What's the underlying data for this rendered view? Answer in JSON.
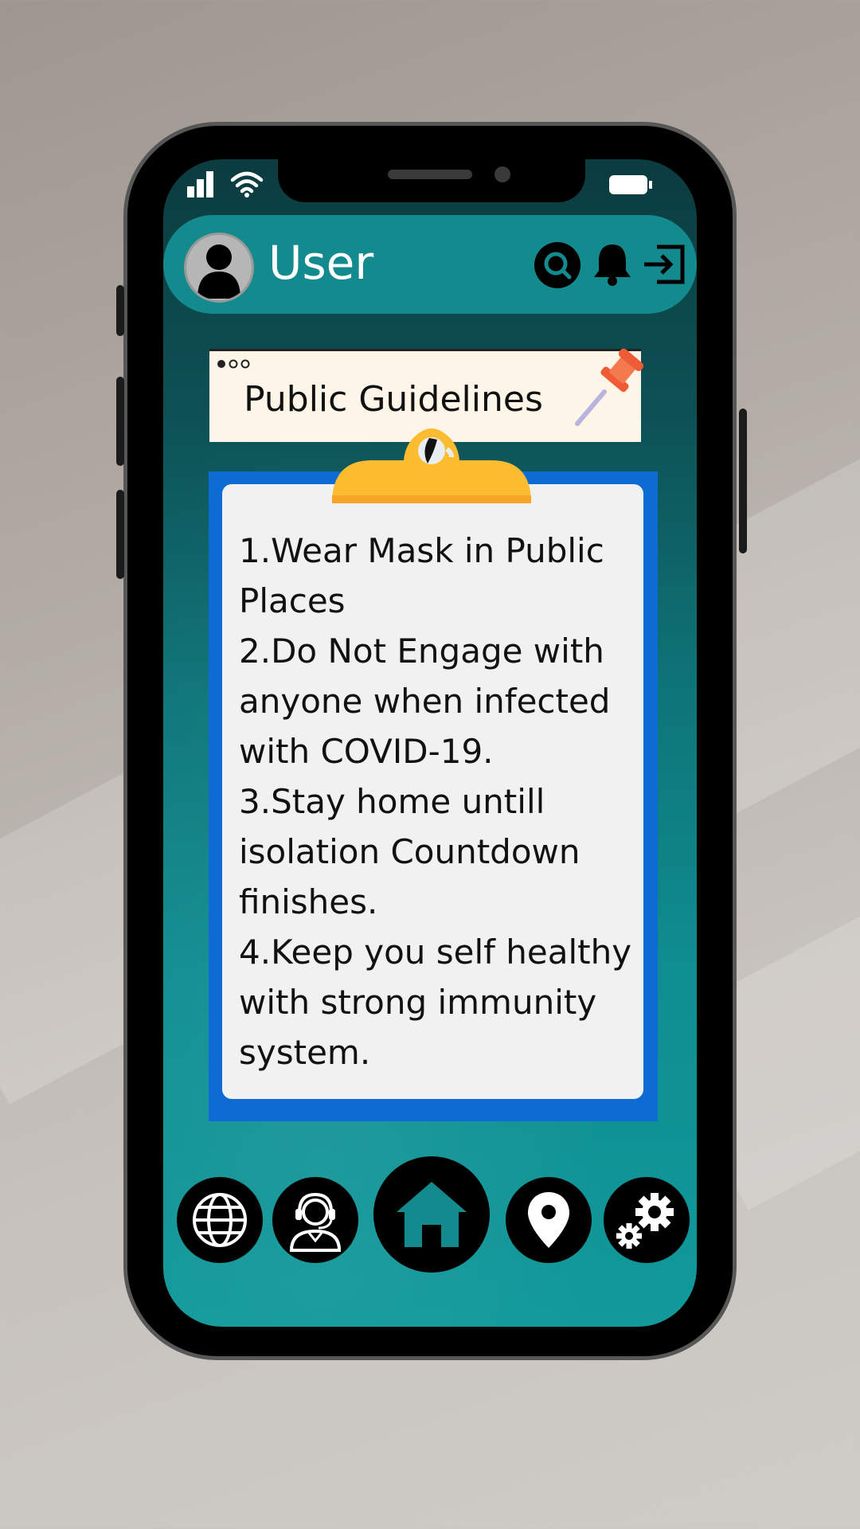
{
  "header": {
    "username": "User"
  },
  "title_card": {
    "title": "Public Guidelines"
  },
  "guidelines": [
    "1.Wear Mask in Public Places",
    "2.Do Not Engage with anyone when infected with COVID-19.",
    "3.Stay home untill isolation Countdown finishes.",
    "4.Keep you self healthy with strong immunity system."
  ],
  "icons": {
    "status": [
      "signal-icon",
      "wifi-icon",
      "battery-icon"
    ],
    "header": [
      "user-avatar-icon",
      "search-icon",
      "bell-icon",
      "logout-icon"
    ],
    "nav": [
      "globe-icon",
      "support-agent-icon",
      "home-icon",
      "location-pin-icon",
      "settings-gears-icon"
    ]
  },
  "colors": {
    "header_bg": "#138a8e",
    "board_blue": "#0d6bd3",
    "clip_yellow": "#fbbc30",
    "pin_red": "#ef5b34",
    "nav_active": "#138a8e"
  }
}
